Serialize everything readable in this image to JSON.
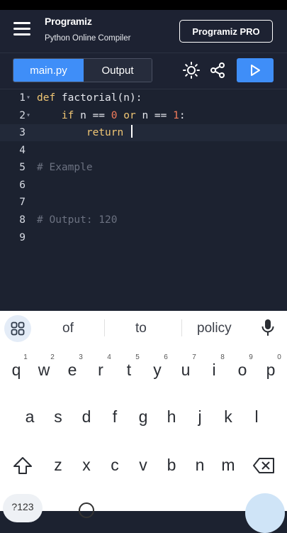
{
  "header": {
    "logo_text": "Programiz",
    "subtitle": "Python Online Compiler",
    "pro_button": "Programiz PRO"
  },
  "toolbar": {
    "tabs": [
      {
        "label": "main.py",
        "active": true
      },
      {
        "label": "Output",
        "active": false
      }
    ],
    "icons": [
      "sun-icon",
      "share-icon",
      "play-icon"
    ]
  },
  "editor": {
    "lines": [
      {
        "n": "1"
      },
      {
        "n": "2"
      },
      {
        "n": "3"
      },
      {
        "n": "4"
      },
      {
        "n": "5"
      },
      {
        "n": "6"
      },
      {
        "n": "7"
      },
      {
        "n": "8"
      },
      {
        "n": "9"
      }
    ],
    "code": {
      "l1_kw": "def",
      "l1_rest": " factorial(n):",
      "l2_indent": "    ",
      "l2_kw1": "if",
      "l2_mid1": " n == ",
      "l2_num1": "0",
      "l2_sp": " ",
      "l2_kw2": "or",
      "l2_mid2": " n == ",
      "l2_num2": "1",
      "l2_end": ":",
      "l3_indent": "        ",
      "l3_kw": "return",
      "l3_rest": " ",
      "l5_comment": "# Example",
      "l8_comment": "# Output: 120"
    },
    "colors": {
      "keyword": "#f0c674",
      "number": "#f47c5c",
      "comment": "#6b7180",
      "accent": "#3f8ef8"
    }
  },
  "keyboard": {
    "suggestions": [
      "of",
      "to",
      "policy"
    ],
    "row1": [
      "q",
      "w",
      "e",
      "r",
      "t",
      "y",
      "u",
      "i",
      "o",
      "p"
    ],
    "row1_hints": [
      "1",
      "2",
      "3",
      "4",
      "5",
      "6",
      "7",
      "8",
      "9",
      "0"
    ],
    "row2": [
      "a",
      "s",
      "d",
      "f",
      "g",
      "h",
      "j",
      "k",
      "l"
    ],
    "row3": [
      "z",
      "x",
      "c",
      "v",
      "b",
      "n",
      "m"
    ],
    "sym_label": "?123"
  }
}
